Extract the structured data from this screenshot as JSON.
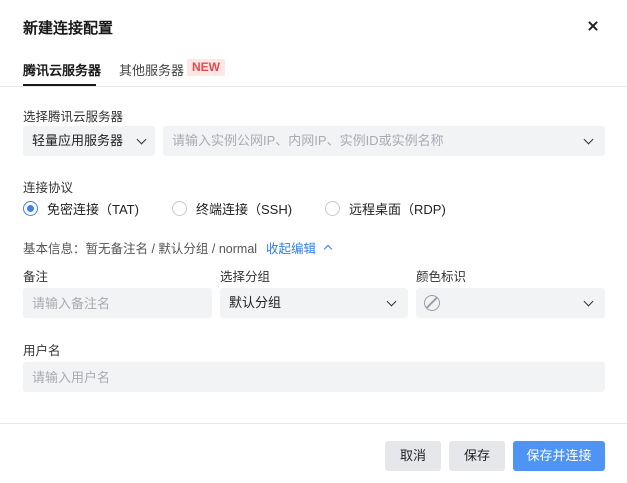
{
  "dialog": {
    "title": "新建连接配置"
  },
  "tabs": [
    {
      "label": "腾讯云服务器",
      "active": true
    },
    {
      "label": "其他服务器",
      "active": false,
      "badge": "NEW"
    }
  ],
  "server": {
    "label": "选择腾讯云服务器",
    "type_value": "轻量应用服务器",
    "instance_placeholder": "请输入实例公网IP、内网IP、实例ID或实例名称"
  },
  "protocol": {
    "label": "连接协议",
    "options": [
      {
        "label": "免密连接（TAT)",
        "checked": true
      },
      {
        "label": "终端连接（SSH)",
        "checked": false
      },
      {
        "label": "远程桌面（RDP)",
        "checked": false
      }
    ]
  },
  "basic_info": {
    "text": "基本信息：暂无备注名 / 默认分组 / normal",
    "toggle": "收起编辑"
  },
  "fields": {
    "remark_label": "备注",
    "remark_placeholder": "请输入备注名",
    "group_label": "选择分组",
    "group_value": "默认分组",
    "color_label": "颜色标识",
    "color_icon": "ban-icon",
    "username_label": "用户名",
    "username_placeholder": "请输入用户名"
  },
  "footer": {
    "cancel": "取消",
    "save": "保存",
    "save_connect": "保存并连接"
  },
  "colors": {
    "primary": "#4f94f5",
    "link": "#2f7df0",
    "badge_bg": "#fde7e7",
    "badge_text": "#e84a4a"
  }
}
